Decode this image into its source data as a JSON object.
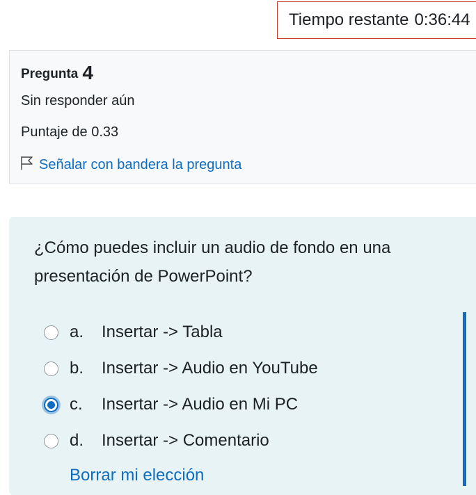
{
  "timer": {
    "label": "Tiempo restante",
    "value": "0:36:44"
  },
  "question_info": {
    "title_label": "Pregunta",
    "number": "4",
    "state": "Sin responder aún",
    "grade": "Puntaje de 0.33",
    "flag_label": "Señalar con bandera la pregunta",
    "flag_icon": "flag-icon"
  },
  "question": {
    "text": "¿Cómo puedes incluir un audio de fondo en una presentación de PowerPoint?",
    "answers": [
      {
        "letter": "a.",
        "text": "Insertar -> Tabla",
        "selected": false
      },
      {
        "letter": "b.",
        "text": "Insertar -> Audio en YouTube",
        "selected": false
      },
      {
        "letter": "c.",
        "text": "Insertar -> Audio en Mi PC",
        "selected": true
      },
      {
        "letter": "d.",
        "text": "Insertar -> Comentario",
        "selected": false
      }
    ],
    "clear_label": "Borrar mi elección"
  },
  "colors": {
    "accent": "#0f6cbf",
    "timer_border": "#c0392b",
    "question_bg": "#e7f3f5",
    "info_bg": "#f8f9fa"
  }
}
